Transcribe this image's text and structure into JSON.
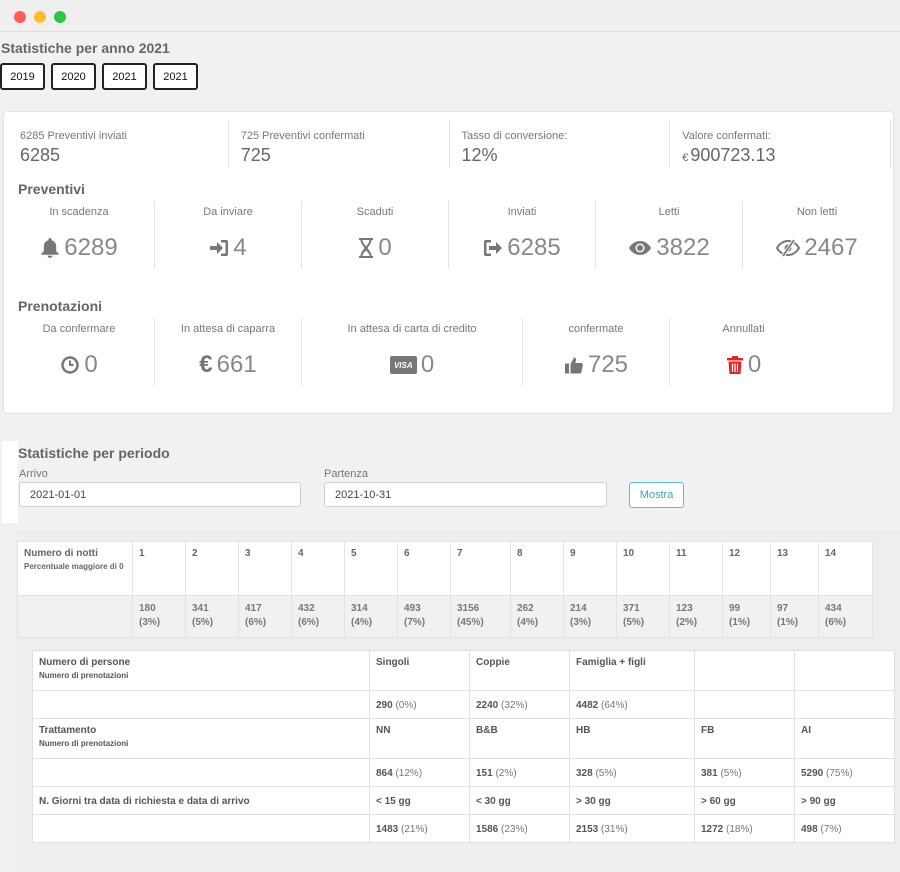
{
  "page": {
    "title": "Statistiche per anno 2021",
    "years": [
      "2019",
      "2020",
      "2021",
      "2021"
    ]
  },
  "top_stats": [
    {
      "label": "6285 Preventivi inviati",
      "value": "6285",
      "currency": ""
    },
    {
      "label": "725 Preventivi confermati",
      "value": "725",
      "currency": ""
    },
    {
      "label": "Tasso di conversione:",
      "value": "12%",
      "currency": ""
    },
    {
      "label": "Valore confermati:",
      "value": "900723.13",
      "currency": "€"
    }
  ],
  "preventivi": {
    "title": "Preventivi",
    "items": [
      {
        "label": "In scadenza",
        "value": "6289",
        "icon": "bell-icon"
      },
      {
        "label": "Da inviare",
        "value": "4",
        "icon": "sign-in-icon"
      },
      {
        "label": "Scaduti",
        "value": "0",
        "icon": "hourglass-icon"
      },
      {
        "label": "Inviati",
        "value": "6285",
        "icon": "sign-out-icon"
      },
      {
        "label": "Letti",
        "value": "3822",
        "icon": "eye-icon"
      },
      {
        "label": "Non letti",
        "value": "2467",
        "icon": "eye-slash-icon"
      }
    ]
  },
  "prenotazioni": {
    "title": "Prenotazioni",
    "items": [
      {
        "label": "Da confermare",
        "value": "0",
        "icon": "clock-icon"
      },
      {
        "label": "In attesa di caparra",
        "value": "661",
        "icon": "euro-icon"
      },
      {
        "label": "In attesa di carta di credito",
        "value": "0",
        "icon": "visa-card-icon",
        "icon_text": "VISA"
      },
      {
        "label": "confermate",
        "value": "725",
        "icon": "thumbs-up-icon"
      },
      {
        "label": "Annullati",
        "value": "0",
        "icon": "trash-icon"
      }
    ]
  },
  "periodo": {
    "title": "Statistiche per periodo",
    "arrivo_label": "Arrivo",
    "arrivo_value": "2021-01-01",
    "partenza_label": "Partenza",
    "partenza_value": "2021-10-31",
    "button": "Mostra"
  },
  "notti": {
    "header": "Numero di notti",
    "subheader": "Percentuale maggiore di 0",
    "nights": [
      "1",
      "2",
      "3",
      "4",
      "5",
      "6",
      "7",
      "8",
      "9",
      "10",
      "11",
      "12",
      "13",
      "14"
    ],
    "counts": [
      "180",
      "341",
      "417",
      "432",
      "314",
      "493",
      "3156",
      "262",
      "214",
      "371",
      "123",
      "99",
      "97",
      "434"
    ],
    "percents": [
      "(3%)",
      "(5%)",
      "(6%)",
      "(6%)",
      "(4%)",
      "(7%)",
      "(45%)",
      "(4%)",
      "(3%)",
      "(5%)",
      "(2%)",
      "(1%)",
      "(1%)",
      "(6%)"
    ]
  },
  "persone": {
    "header": "Numero di persone",
    "subheader": "Numero di prenotazioni",
    "cols": [
      "Singoli",
      "Coppie",
      "Famiglia + figli",
      "",
      ""
    ],
    "values": [
      {
        "n": "290",
        "p": "(0%)"
      },
      {
        "n": "2240",
        "p": "(32%)"
      },
      {
        "n": "4482",
        "p": "(64%)"
      }
    ]
  },
  "trattamento": {
    "header": "Trattamento",
    "subheader": "Numero di prenotazioni",
    "cols": [
      "NN",
      "B&B",
      "HB",
      "FB",
      "AI"
    ],
    "values": [
      {
        "n": "864",
        "p": "(12%)"
      },
      {
        "n": "151",
        "p": "(2%)"
      },
      {
        "n": "328",
        "p": "(5%)"
      },
      {
        "n": "381",
        "p": "(5%)"
      },
      {
        "n": "5290",
        "p": "(75%)"
      }
    ]
  },
  "giorni": {
    "header": "N. Giorni tra data di richiesta e data di arrivo",
    "cols": [
      "< 15 gg",
      "< 30 gg",
      "> 30 gg",
      "> 60 gg",
      "> 90 gg"
    ],
    "values": [
      {
        "n": "1483",
        "p": "(21%)"
      },
      {
        "n": "1586",
        "p": "(23%)"
      },
      {
        "n": "2153",
        "p": "(31%)"
      },
      {
        "n": "1272",
        "p": "(18%)"
      },
      {
        "n": "498",
        "p": "(7%)"
      }
    ]
  },
  "colors": {
    "accent": "#5bc0c8",
    "danger": "#e02424",
    "icon": "#888888"
  }
}
